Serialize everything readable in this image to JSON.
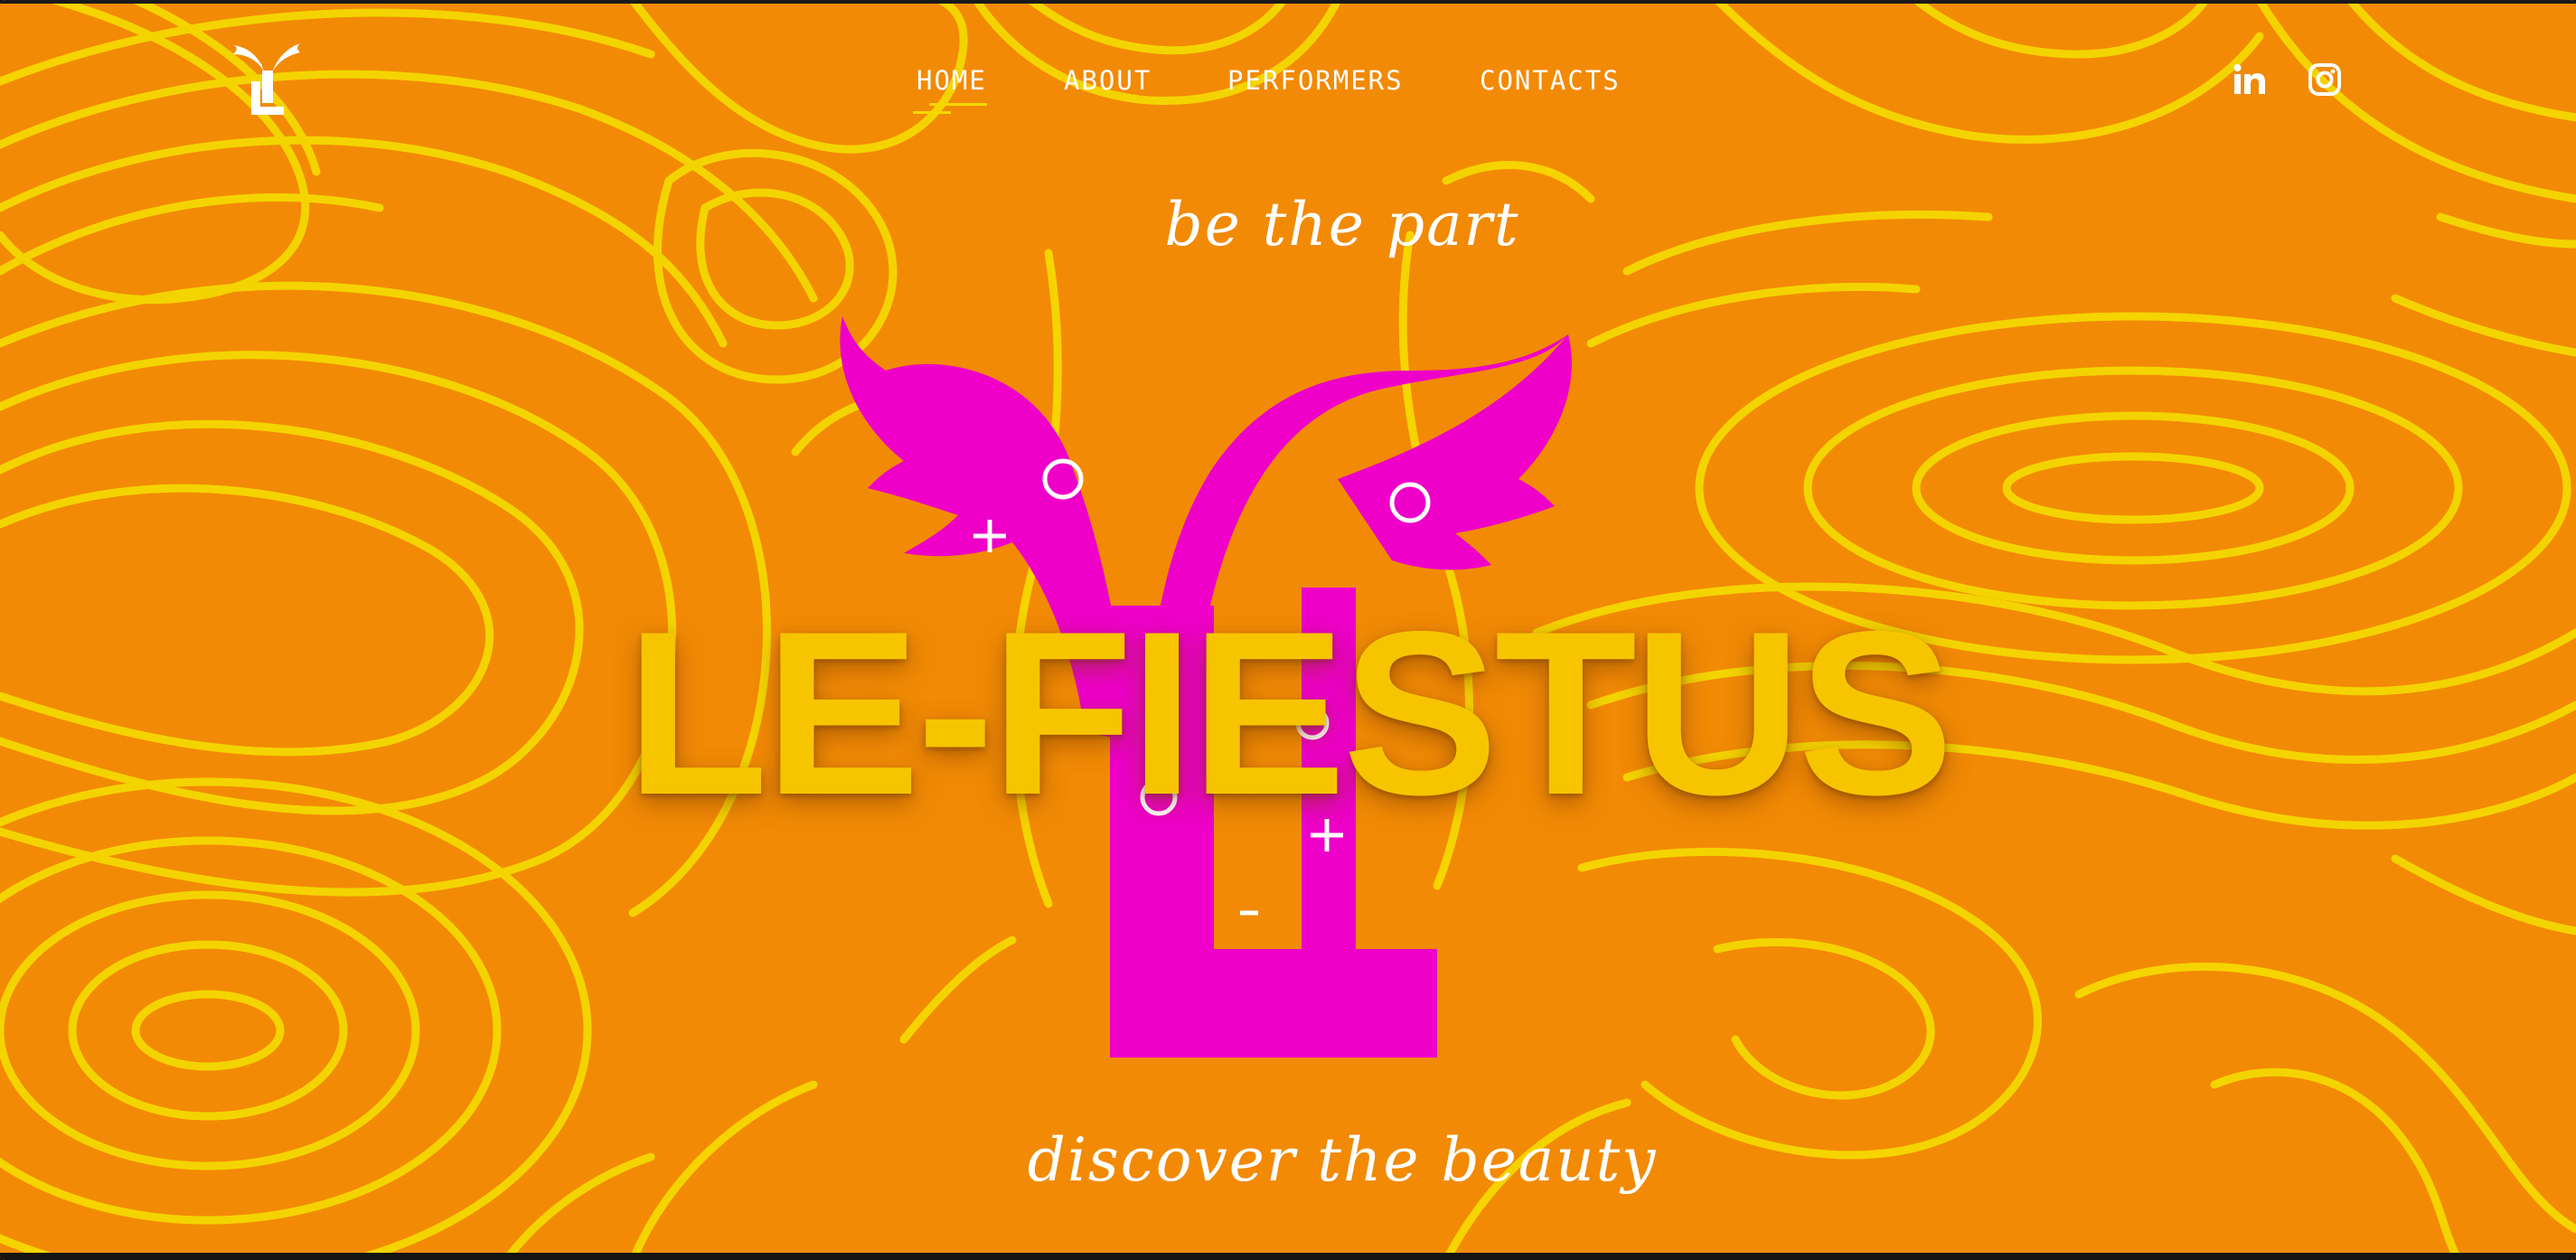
{
  "nav": {
    "items": [
      {
        "label": "HOME",
        "active": true
      },
      {
        "label": "ABOUT",
        "active": false
      },
      {
        "label": "PERFORMERS",
        "active": false
      },
      {
        "label": "CONTACTS",
        "active": false
      }
    ]
  },
  "social": {
    "linkedin_icon": "linkedin-icon",
    "instagram_icon": "instagram-icon"
  },
  "hero": {
    "tagline_top": "be the part",
    "brand": "LE-FIESTUS",
    "tagline_bottom": "discover the beauty"
  },
  "colors": {
    "background": "#f28a05",
    "contour_lines": "#f5d800",
    "brand_text": "#f7c500",
    "mascot": "#ee00c8",
    "nav_text": "#ffffff"
  }
}
